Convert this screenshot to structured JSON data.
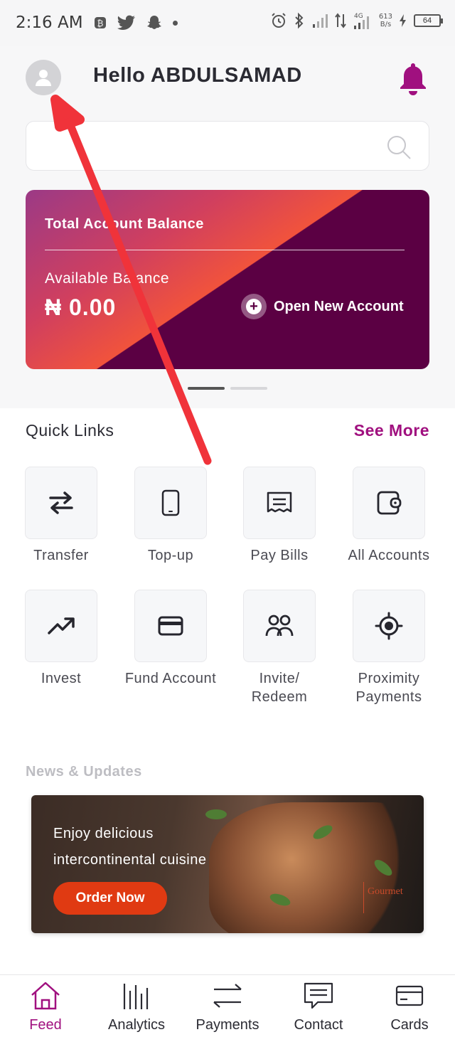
{
  "status_bar": {
    "time": "2:16 AM",
    "speed_value": "613",
    "speed_unit": "B/s",
    "battery": "64"
  },
  "header": {
    "greeting": "Hello ABDULSAMAD"
  },
  "search": {
    "placeholder": ""
  },
  "balance_card": {
    "title": "Total Account Balance",
    "available_label": "Available Balance",
    "amount": "₦ 0.00",
    "open_account_label": "Open New Account"
  },
  "quick_links": {
    "title": "Quick Links",
    "see_more": "See More",
    "items": [
      {
        "label": "Transfer"
      },
      {
        "label": "Top-up"
      },
      {
        "label": "Pay Bills"
      },
      {
        "label": "All Accounts"
      },
      {
        "label": "Invest"
      },
      {
        "label": "Fund Account"
      },
      {
        "label": "Invite/ Redeem"
      },
      {
        "label": "Proximity Payments"
      }
    ]
  },
  "news": {
    "title": "News & Updates",
    "banner_line1": "Enjoy delicious",
    "banner_line2": "intercontinental cuisine",
    "order_button": "Order Now",
    "brand": "Gourmet"
  },
  "bottom_nav": {
    "items": [
      {
        "label": "Feed",
        "active": true
      },
      {
        "label": "Analytics"
      },
      {
        "label": "Payments"
      },
      {
        "label": "Contact"
      },
      {
        "label": "Cards"
      }
    ]
  },
  "colors": {
    "brand": "#a0107f",
    "card_dark": "#5b0043",
    "card_accent": "#f1533c",
    "order_button": "#e03a12",
    "annotation_arrow": "#f0333a"
  }
}
